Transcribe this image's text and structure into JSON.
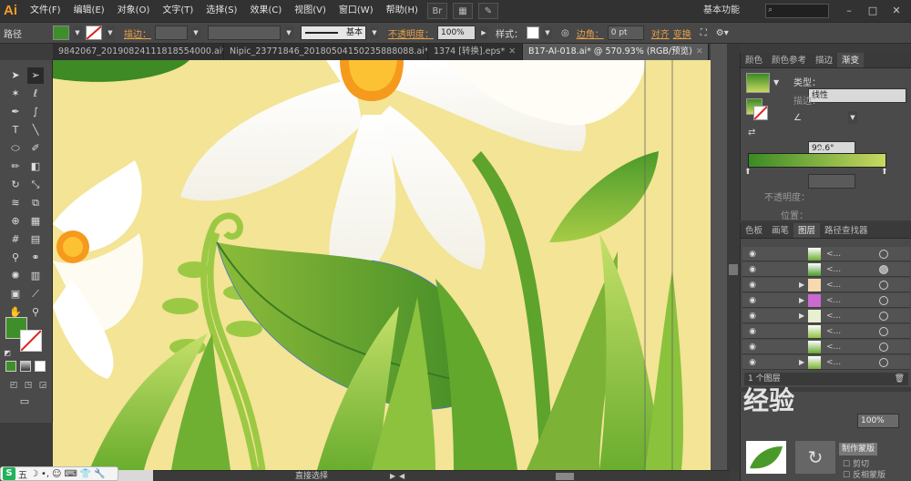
{
  "app": {
    "logo": "Ai",
    "workspace": "基本功能",
    "search_placeholder": "",
    "window_controls": [
      "–",
      "□",
      "✕"
    ]
  },
  "menu": [
    "文件(F)",
    "编辑(E)",
    "对象(O)",
    "文字(T)",
    "选择(S)",
    "效果(C)",
    "视图(V)",
    "窗口(W)",
    "帮助(H)"
  ],
  "control_bar": {
    "object_type": "路径",
    "fill_color": "#3e8f2a",
    "stroke_label": "描边：",
    "stroke_style": "基本",
    "opacity_label": "不透明度：",
    "opacity_value": "100%",
    "style_label": "样式：",
    "corner_label": "边角：",
    "corner_value": "0 pt",
    "align_label": "对齐",
    "transform_label": "变换"
  },
  "tabs": [
    {
      "label": "9842067_20190824111818554000.ai*",
      "active": false
    },
    {
      "label": "Nipic_23771846_20180504150235888088.ai*",
      "active": false
    },
    {
      "label": "1374 [转换].eps*",
      "active": false
    },
    {
      "label": "B17-AI-018.ai* @ 570.93% (RGB/预览)",
      "active": true
    }
  ],
  "gradient_panel": {
    "tabs": [
      "颜色",
      "颜色参考",
      "描边",
      "渐变"
    ],
    "active_tab": "渐变",
    "type_label": "类型：",
    "type_value": "线性",
    "stroke_label": "描边：",
    "angle_value": "99.6°",
    "opacity_label": "不透明度：",
    "location_label": "位置：",
    "gradient_start": "#3a8a24",
    "gradient_end": "#c8d860"
  },
  "layers_panel": {
    "tabs": [
      "色板",
      "画笔",
      "图层",
      "路径查找器"
    ],
    "active_tab": "图层",
    "footer": "1 个图层"
  },
  "bottom_panel": {
    "opacity_value": "100%",
    "make_mask": "制作蒙版",
    "clip_label": "剪切",
    "invert_label": "反相蒙版"
  },
  "status": {
    "tool_name": "直接选择"
  },
  "ime": {
    "label": "五"
  },
  "watermark": "经验"
}
